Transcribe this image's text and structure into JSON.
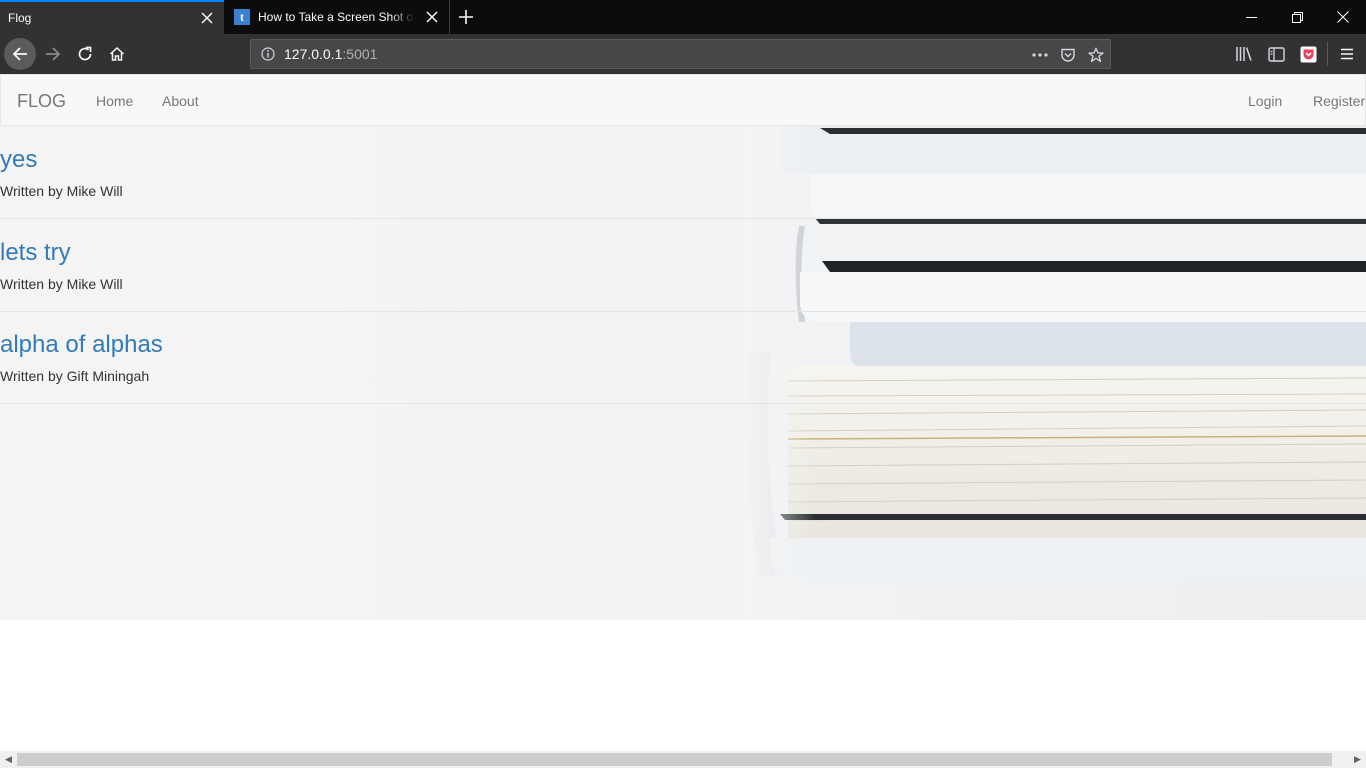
{
  "browser": {
    "tabs": [
      {
        "title": "Flog",
        "active": true
      },
      {
        "title": "How to Take a Screen Shot on a",
        "active": false
      }
    ],
    "url_host": "127.0.0.1",
    "url_port": ":5001",
    "accent_color": "#0a84ff"
  },
  "site": {
    "brand": "FLOG",
    "nav_left": [
      "Home",
      "About"
    ],
    "nav_right": [
      "Login",
      "Register"
    ],
    "link_color": "#337ab7"
  },
  "posts": [
    {
      "title": "yes",
      "meta": "Written by Mike Will"
    },
    {
      "title": "lets try",
      "meta": "Written by Mike Will"
    },
    {
      "title": "alpha of alphas",
      "meta": "Written by Gift Miningah"
    }
  ]
}
